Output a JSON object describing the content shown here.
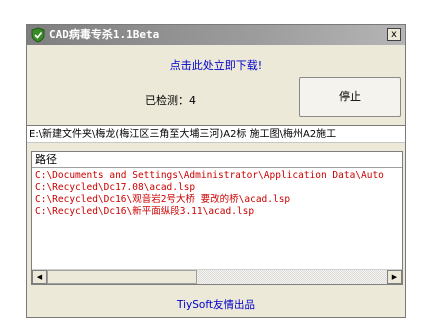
{
  "window": {
    "title": "CAD病毒专杀1.1Beta",
    "close_label": "x"
  },
  "download_link": "点击此处立即下载!",
  "status": {
    "detected_label": "已检测：4"
  },
  "stop_button": "停止",
  "current_path": "E:\\新建文件夹\\梅龙(梅江区三角至大埔三河)A2标 施工图\\梅州A2施工",
  "results": {
    "header": "路径",
    "rows": [
      "C:\\Documents and Settings\\Administrator\\Application Data\\Auto",
      "C:\\Recycled\\Dc17.08\\acad.lsp",
      "C:\\Recycled\\Dc16\\观音岩2号大桥  要改的桥\\acad.lsp",
      "C:\\Recycled\\Dc16\\新平面纵段3.11\\acad.lsp"
    ]
  },
  "scrollbar": {
    "left_arrow": "◀",
    "right_arrow": "▶"
  },
  "footer": "TiySoft友情出品",
  "icons": {
    "app": "shield-icon",
    "close": "close-icon",
    "scroll_left": "arrow-left-icon",
    "scroll_right": "arrow-right-icon"
  },
  "colors": {
    "titlebar": "#9c9c9c",
    "link": "#0000cc",
    "result_text": "#cc0000",
    "window_bg": "#ece9d8"
  }
}
